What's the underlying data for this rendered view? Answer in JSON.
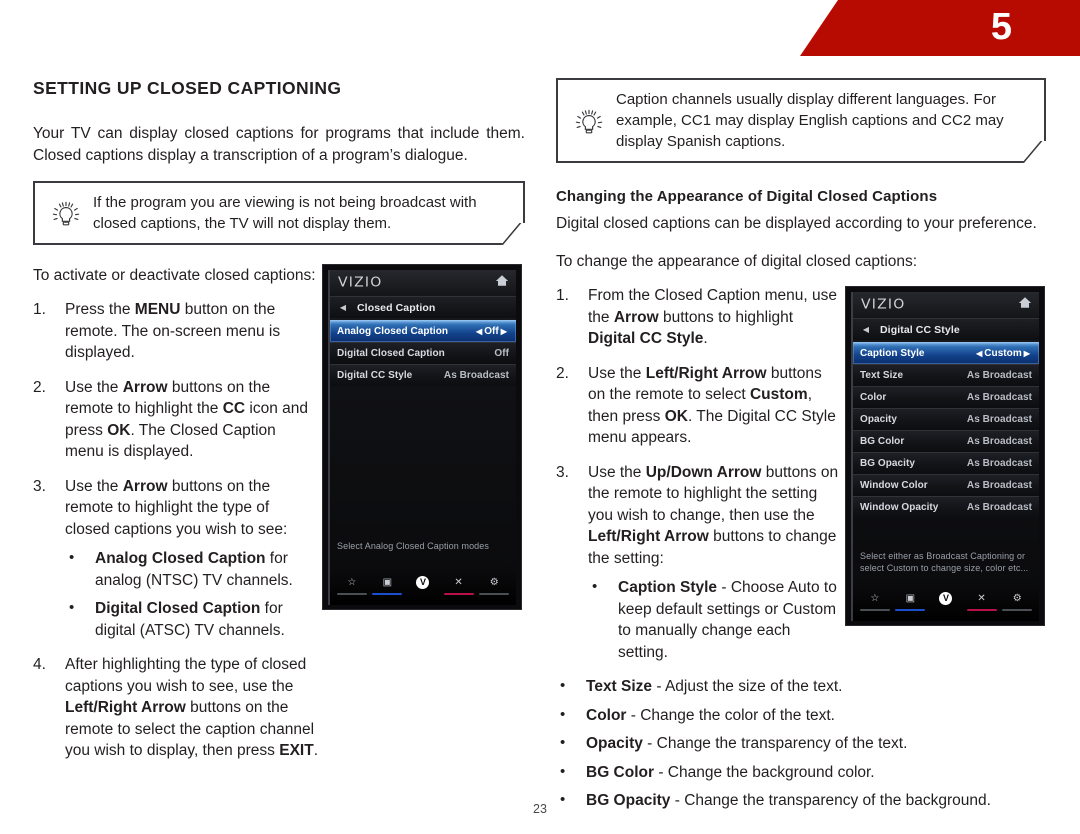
{
  "header": {
    "chapter_number": "5",
    "banner_color": "#b70b02"
  },
  "left_column": {
    "section_title": "SETTING UP CLOSED CAPTIONING",
    "intro_paragraph": "Your TV can display closed captions for programs that include them. Closed captions display a transcription of a program’s dialogue.",
    "tip": {
      "icon": "lightbulb-icon",
      "text": "If the program you are viewing is not being broadcast with closed captions, the TV will not display them."
    },
    "lead_in": "To activate or deactivate closed captions:",
    "steps": [
      {
        "num": "1.",
        "parts": [
          {
            "t": "Press the ",
            "b": false
          },
          {
            "t": "MENU",
            "b": true
          },
          {
            "t": " button on the remote. The on-screen menu is displayed.",
            "b": false
          }
        ]
      },
      {
        "num": "2.",
        "parts": [
          {
            "t": "Use the ",
            "b": false
          },
          {
            "t": "Arrow",
            "b": true
          },
          {
            "t": " buttons on the remote to highlight the ",
            "b": false
          },
          {
            "t": "CC",
            "b": true
          },
          {
            "t": " icon and press ",
            "b": false
          },
          {
            "t": "OK",
            "b": true
          },
          {
            "t": ". The Closed Caption menu is displayed.",
            "b": false
          }
        ]
      },
      {
        "num": "3.",
        "parts": [
          {
            "t": "Use the ",
            "b": false
          },
          {
            "t": "Arrow",
            "b": true
          },
          {
            "t": " buttons on the remote to highlight the type of closed captions you wish to see:",
            "b": false
          }
        ],
        "bullets": [
          [
            {
              "t": "Analog Closed Caption",
              "b": true
            },
            {
              "t": " for analog (NTSC) TV channels.",
              "b": false
            }
          ],
          [
            {
              "t": "Digital Closed Caption",
              "b": true
            },
            {
              "t": " for digital (ATSC) TV channels.",
              "b": false
            }
          ]
        ]
      },
      {
        "num": "4.",
        "parts": [
          {
            "t": "After highlighting the type of closed captions you wish to see, use the ",
            "b": false
          },
          {
            "t": "Left/Right Arrow",
            "b": true
          },
          {
            "t": " buttons on the remote to select the caption channel you wish to display, then press ",
            "b": false
          },
          {
            "t": "EXIT",
            "b": true
          },
          {
            "t": ".",
            "b": false
          }
        ]
      }
    ]
  },
  "right_column": {
    "tip": {
      "icon": "lightbulb-icon",
      "text": "Caption channels usually display different languages. For example, CC1 may display English captions and CC2 may display Spanish captions."
    },
    "sub_title": "Changing the Appearance of Digital Closed Captions",
    "paragraph": "Digital closed captions can be displayed according to your preference.",
    "lead_in": "To change the appearance of digital closed captions:",
    "steps": [
      {
        "num": "1.",
        "parts": [
          {
            "t": "From the Closed Caption menu, use the ",
            "b": false
          },
          {
            "t": "Arrow",
            "b": true
          },
          {
            "t": " buttons to highlight ",
            "b": false
          },
          {
            "t": "Digital CC Style",
            "b": true
          },
          {
            "t": ".",
            "b": false
          }
        ]
      },
      {
        "num": "2.",
        "parts": [
          {
            "t": "Use the ",
            "b": false
          },
          {
            "t": "Left/Right Arrow",
            "b": true
          },
          {
            "t": " buttons on the remote to select ",
            "b": false
          },
          {
            "t": "Custom",
            "b": true
          },
          {
            "t": ", then press ",
            "b": false
          },
          {
            "t": "OK",
            "b": true
          },
          {
            "t": ". The Digital CC Style menu appears.",
            "b": false
          }
        ]
      },
      {
        "num": "3.",
        "parts": [
          {
            "t": "Use the ",
            "b": false
          },
          {
            "t": "Up/Down Arrow",
            "b": true
          },
          {
            "t": " buttons on the remote to highlight the setting you wish to change, then use the ",
            "b": false
          },
          {
            "t": "Left/Right Arrow",
            "b": true
          },
          {
            "t": " buttons to change the setting:",
            "b": false
          }
        ],
        "bullets": [
          [
            {
              "t": "Caption Style",
              "b": true
            },
            {
              "t": " - Choose Auto to keep default settings or Custom to manually change each setting.",
              "b": false
            }
          ]
        ]
      }
    ],
    "wide_bullets": [
      [
        {
          "t": "Text Size",
          "b": true
        },
        {
          "t": " - Adjust the size of the text.",
          "b": false
        }
      ],
      [
        {
          "t": "Color",
          "b": true
        },
        {
          "t": " - Change the color of the text.",
          "b": false
        }
      ],
      [
        {
          "t": "Opacity",
          "b": true
        },
        {
          "t": " - Change the transparency of the text.",
          "b": false
        }
      ],
      [
        {
          "t": "BG Color",
          "b": true
        },
        {
          "t": " - Change the background color.",
          "b": false
        }
      ],
      [
        {
          "t": "BG Opacity",
          "b": true
        },
        {
          "t": " - Change the transparency of the background.",
          "b": false
        }
      ]
    ]
  },
  "tv_screenshot_left": {
    "brand": "VIZIO",
    "home_icon": "home-icon",
    "back_arrow": "◀",
    "menu_title": "Closed Caption",
    "rows": [
      {
        "label": "Analog Closed Caption",
        "value": "Off",
        "selected": true,
        "arrows": true
      },
      {
        "label": "Digital Closed Caption",
        "value": "Off",
        "selected": false,
        "arrows": false
      },
      {
        "label": "Digital CC Style",
        "value": "As Broadcast",
        "selected": false,
        "arrows": false
      }
    ],
    "help_text": "Select Analog Closed Caption modes",
    "bottom_icons": [
      {
        "name": "star-icon",
        "glyph": "☆",
        "underline": "#4a4e55"
      },
      {
        "name": "picture-icon",
        "glyph": "▣",
        "underline": "#1b4fd0"
      },
      {
        "name": "vizio-v-icon",
        "glyph": "V",
        "underline": "none"
      },
      {
        "name": "close-x-icon",
        "glyph": "✕",
        "underline": "#b7104a"
      },
      {
        "name": "settings-gear-icon",
        "glyph": "⚙",
        "underline": "#4a4e55"
      }
    ]
  },
  "tv_screenshot_right": {
    "brand": "VIZIO",
    "home_icon": "home-icon",
    "back_arrow": "◀",
    "menu_title": "Digital CC Style",
    "rows": [
      {
        "label": "Caption Style",
        "value": "Custom",
        "selected": true,
        "arrows": true
      },
      {
        "label": "Text Size",
        "value": "As Broadcast",
        "selected": false,
        "arrows": false
      },
      {
        "label": "Color",
        "value": "As Broadcast",
        "selected": false,
        "arrows": false
      },
      {
        "label": "Opacity",
        "value": "As Broadcast",
        "selected": false,
        "arrows": false
      },
      {
        "label": "BG Color",
        "value": "As Broadcast",
        "selected": false,
        "arrows": false
      },
      {
        "label": "BG Opacity",
        "value": "As Broadcast",
        "selected": false,
        "arrows": false
      },
      {
        "label": "Window Color",
        "value": "As Broadcast",
        "selected": false,
        "arrows": false
      },
      {
        "label": "Window Opacity",
        "value": "As Broadcast",
        "selected": false,
        "arrows": false
      }
    ],
    "help_text": "Select either as Broadcast Captioning or select Custom to change size, color etc...",
    "bottom_icons": [
      {
        "name": "star-icon",
        "glyph": "☆",
        "underline": "#4a4e55"
      },
      {
        "name": "picture-icon",
        "glyph": "▣",
        "underline": "#1b4fd0"
      },
      {
        "name": "vizio-v-icon",
        "glyph": "V",
        "underline": "none"
      },
      {
        "name": "close-x-icon",
        "glyph": "✕",
        "underline": "#b7104a"
      },
      {
        "name": "settings-gear-icon",
        "glyph": "⚙",
        "underline": "#4a4e55"
      }
    ]
  },
  "footer": {
    "page_number": "23"
  }
}
